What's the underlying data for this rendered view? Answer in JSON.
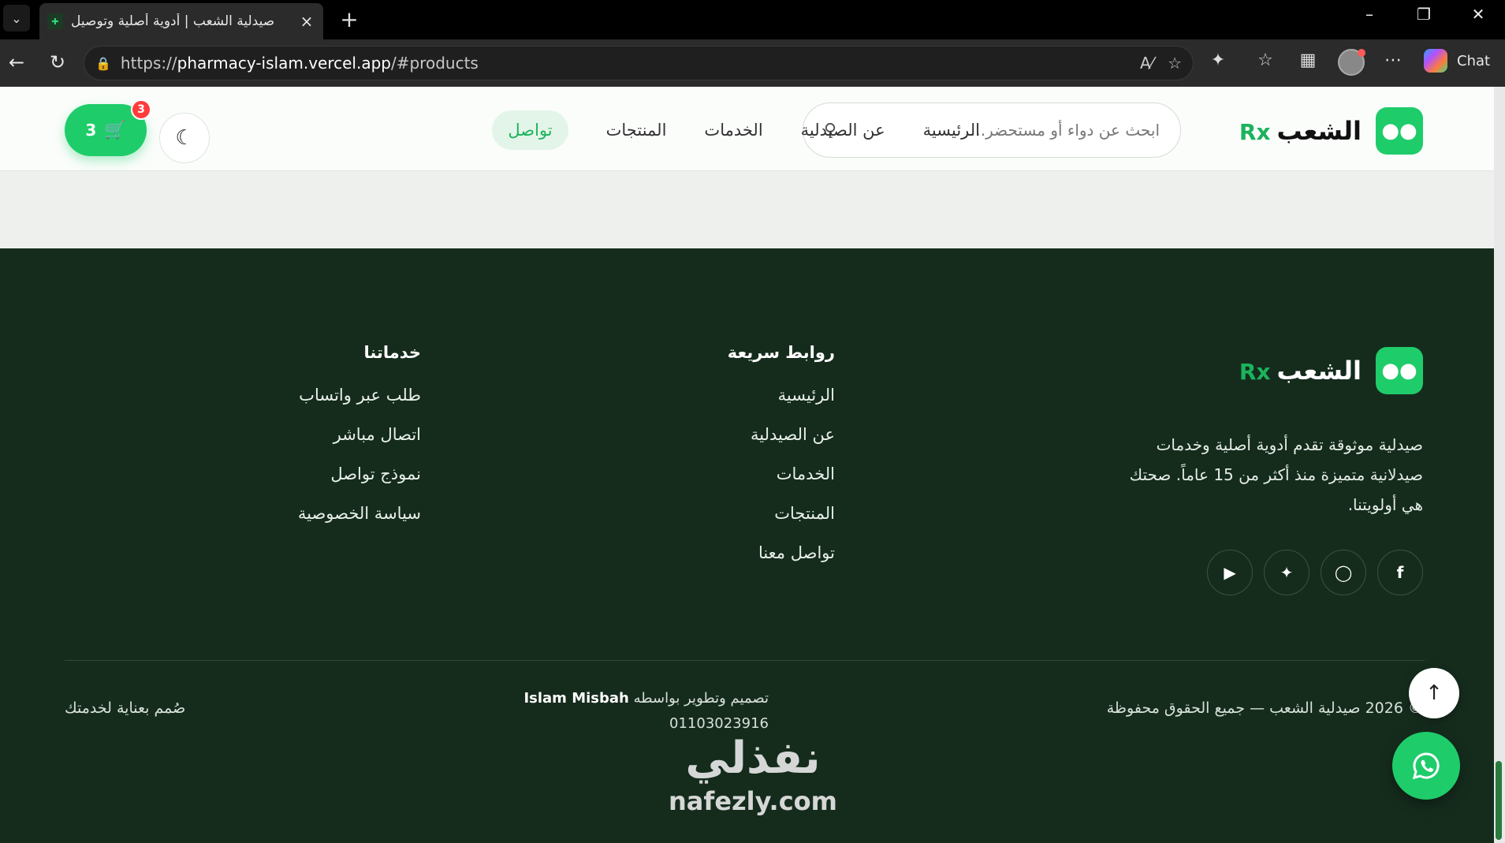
{
  "browser": {
    "tab_title": "صيدلية الشعب | أدوية أصلية وتوصيل",
    "url_prefix": "https://",
    "url_host": "pharmacy-islam.vercel.app",
    "url_path": "/#products",
    "chat_label": "Chat"
  },
  "header": {
    "brand_name": "الشعب",
    "brand_rx": "Rx",
    "search_placeholder": "ابحث عن دواء أو مستحضر...",
    "nav": [
      "الرئيسية",
      "عن الصيدلية",
      "الخدمات",
      "المنتجات"
    ],
    "nav_active": "تواصل",
    "cart_count": "3",
    "cart_badge": "3"
  },
  "footer": {
    "brand_name": "الشعب",
    "brand_rx": "Rx",
    "description": "صيدلية موثوقة تقدم أدوية أصلية وخدمات صيدلانية متميزة منذ أكثر من 15 عاماً. صحتك هي أولويتنا.",
    "social_icons": [
      "facebook-icon",
      "instagram-icon",
      "twitter-icon",
      "youtube-icon"
    ],
    "quick_links": {
      "title": "روابط سريعة",
      "items": [
        "الرئيسية",
        "عن الصيدلية",
        "الخدمات",
        "المنتجات",
        "تواصل معنا"
      ]
    },
    "services": {
      "title": "خدماتنا",
      "items": [
        "طلب عبر واتساب",
        "اتصال مباشر",
        "نموذج تواصل",
        "سياسة الخصوصية"
      ]
    },
    "copyright": "© 2026 صيدلية الشعب — جميع الحقوق محفوظة",
    "dev_text": "تصميم وتطوير بواسطه",
    "dev_name": "Islam Misbah",
    "dev_phone": "01103023916",
    "credit": "صُمم بعناية لخدمتك"
  },
  "watermark": {
    "arabic": "نفذلي",
    "latin": "nafezly.com"
  },
  "colors": {
    "brand_green": "#1fcc6a",
    "footer_bg": "#152c1d",
    "badge_red": "#ff3b3b"
  }
}
